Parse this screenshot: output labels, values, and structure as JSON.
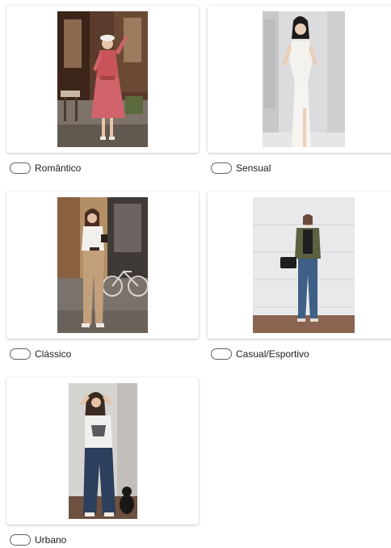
{
  "options": [
    {
      "label": "Romântico"
    },
    {
      "label": "Sensual"
    },
    {
      "label": "Clássico"
    },
    {
      "label": "Casual/Esportivo"
    },
    {
      "label": "Urbano"
    }
  ],
  "colors": {
    "radio_border": "#5f6368",
    "text": "#202124",
    "card_bg": "#ffffff"
  }
}
